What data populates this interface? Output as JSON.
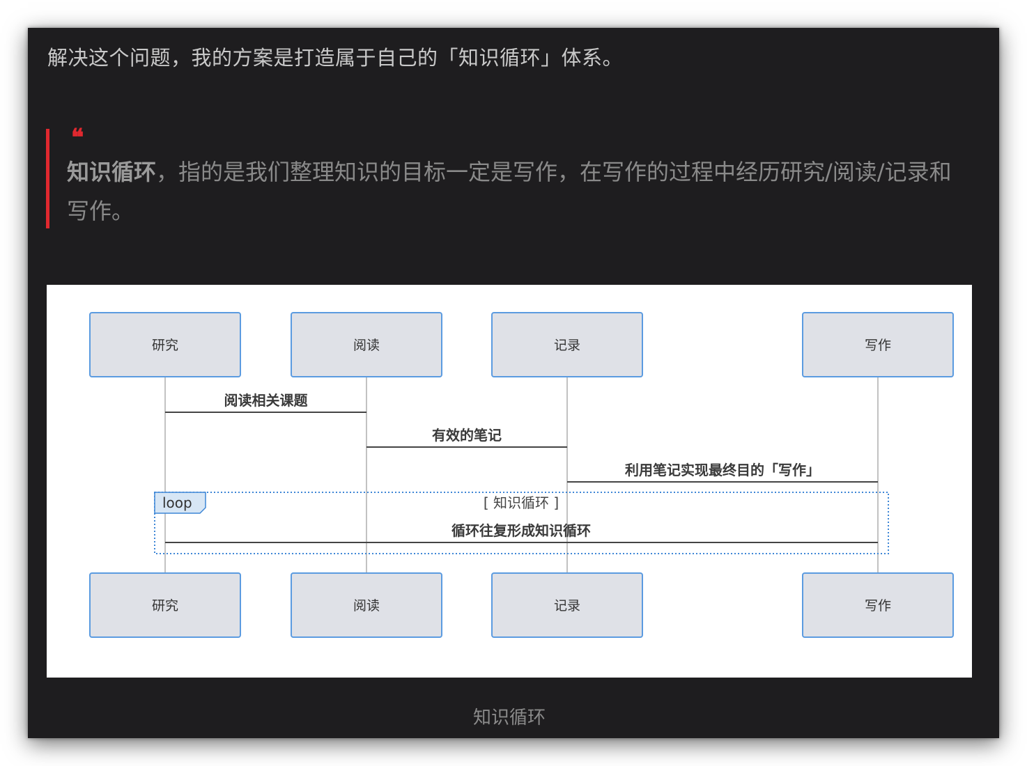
{
  "article": {
    "lead": "解决这个问题，我的方案是打造属于自己的「知识循环」体系。",
    "quote": {
      "mark": "❝",
      "term": "知识循环",
      "text": "，指的是我们整理知识的目标一定是写作，在写作的过程中经历研究/阅读/记录和写作。"
    },
    "caption": "知识循环"
  },
  "diagram": {
    "participants": [
      "研究",
      "阅读",
      "记录",
      "写作"
    ],
    "messages": [
      {
        "from": "研究",
        "to": "阅读",
        "label": "阅读相关课题"
      },
      {
        "from": "阅读",
        "to": "记录",
        "label": "有效的笔记"
      },
      {
        "from": "记录",
        "to": "写作",
        "label": "利用笔记实现最终目的「写作」"
      }
    ],
    "loop": {
      "tag": "loop",
      "condition": "[ 知识循环 ]",
      "message": {
        "from": "写作",
        "to": "研究",
        "label": "循环往复形成知识循环"
      }
    },
    "colors": {
      "box_fill": "#dfe1e7",
      "box_stroke": "#5b9be0",
      "lifeline": "#9a9a9a",
      "arrow": "#444444",
      "loop_border": "#3d86d6",
      "quote_accent": "#e0282f",
      "background": "#1e1d1f"
    }
  }
}
